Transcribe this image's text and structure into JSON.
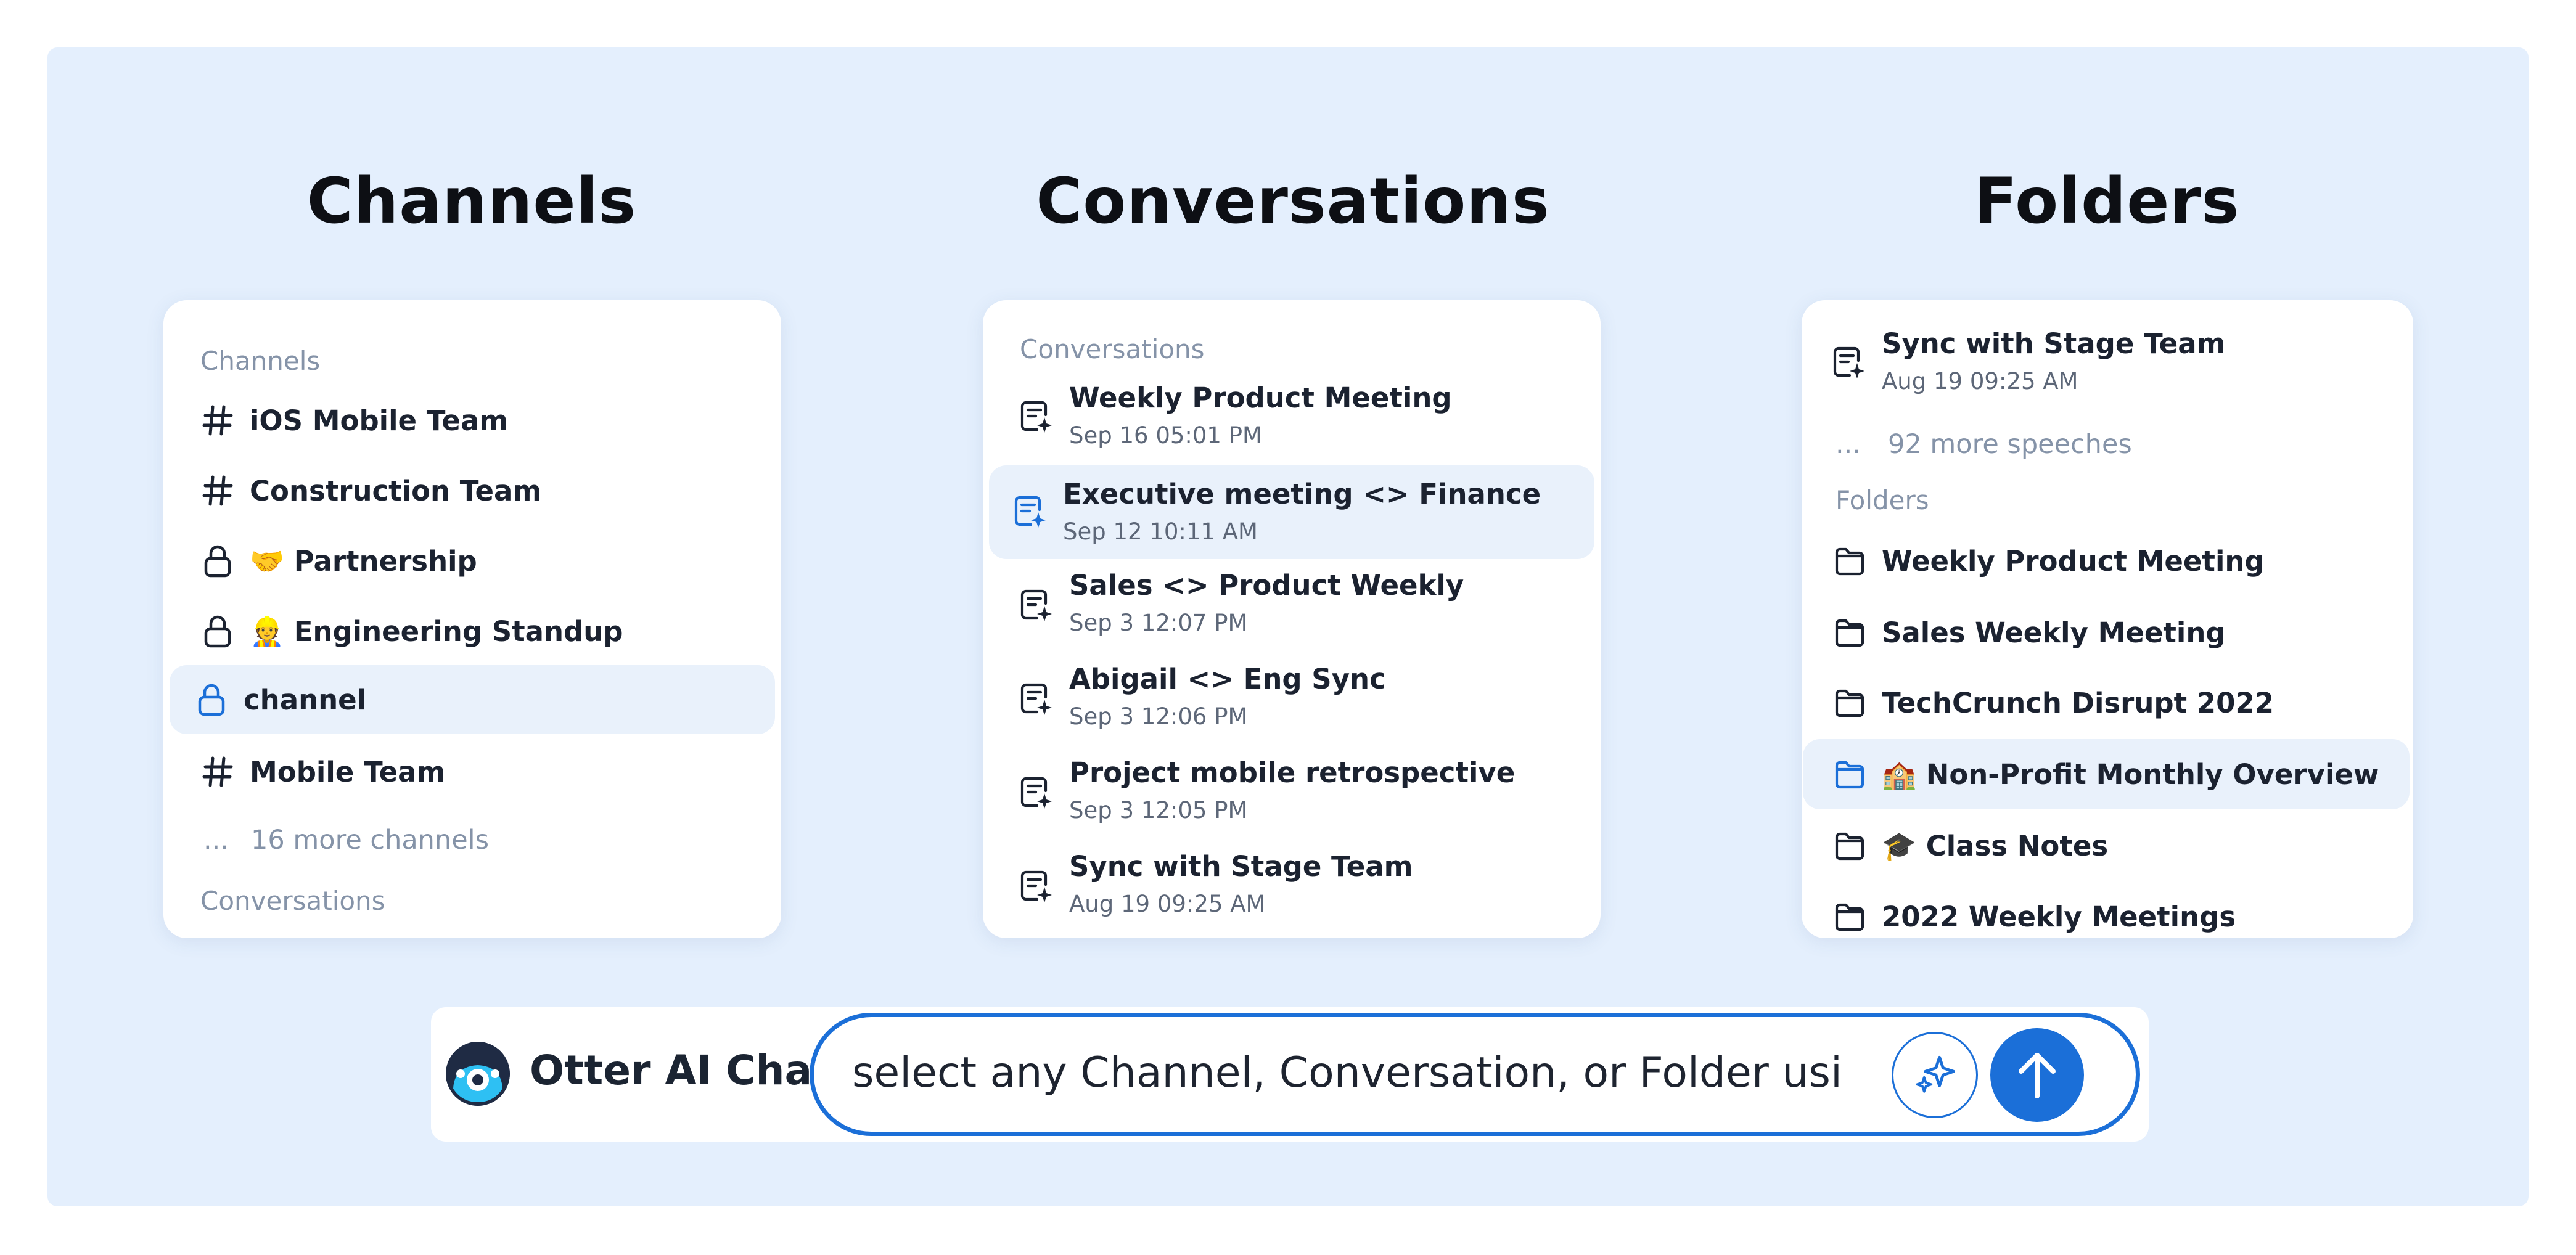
{
  "columns": {
    "channels": {
      "title": "Channels"
    },
    "conversations": {
      "title": "Conversations"
    },
    "folders": {
      "title": "Folders"
    }
  },
  "channels_card": {
    "section_label": "Channels",
    "items": [
      {
        "icon": "hash-icon",
        "label": "iOS Mobile Team"
      },
      {
        "icon": "hash-icon",
        "label": "Construction Team"
      },
      {
        "icon": "lock-icon",
        "label": "🤝 Partnership"
      },
      {
        "icon": "lock-icon",
        "label": "👷 Engineering Standup"
      },
      {
        "icon": "lock-icon",
        "label": "channel",
        "selected": true
      },
      {
        "icon": "hash-icon",
        "label": "Mobile Team"
      }
    ],
    "more_dots": "...",
    "more_text": "16 more channels",
    "next_section_label": "Conversations"
  },
  "conversations_card": {
    "section_label": "Conversations",
    "items": [
      {
        "icon": "ai-notes-icon",
        "title": "Weekly Product Meeting",
        "date": "Sep 16 05:01 PM"
      },
      {
        "icon": "ai-notes-icon",
        "title": "Executive meeting <> Finance",
        "date": "Sep 12 10:11 AM",
        "selected": true
      },
      {
        "icon": "ai-notes-icon",
        "title": "Sales <> Product Weekly",
        "date": "Sep 3 12:07 PM"
      },
      {
        "icon": "ai-notes-icon",
        "title": "Abigail <> Eng Sync",
        "date": "Sep 3 12:06 PM"
      },
      {
        "icon": "ai-notes-icon",
        "title": "Project mobile retrospective",
        "date": "Sep 3 12:05 PM"
      },
      {
        "icon": "ai-notes-icon",
        "title": "Sync with Stage Team",
        "date": "Aug 19 09:25 AM"
      }
    ]
  },
  "folders_card": {
    "top_item": {
      "icon": "ai-notes-icon",
      "title": "Sync with Stage Team",
      "date": "Aug 19 09:25 AM"
    },
    "more_dots": "...",
    "more_text": "92 more speeches",
    "section_label": "Folders",
    "items": [
      {
        "icon": "folder-icon",
        "label": "Weekly Product Meeting"
      },
      {
        "icon": "folder-icon",
        "label": "Sales Weekly Meeting"
      },
      {
        "icon": "folder-icon",
        "label": "TechCrunch Disrupt 2022"
      },
      {
        "icon": "folder-icon",
        "label": "🏫 Non-Profit Monthly Overview",
        "selected": true
      },
      {
        "icon": "folder-icon",
        "label": "🎓 Class Notes"
      },
      {
        "icon": "folder-icon",
        "label": "2022 Weekly Meetings"
      }
    ]
  },
  "chat": {
    "title": "Otter AI Chat",
    "input_value": "select any Channel, Conversation, or Folder using #",
    "spark_icon": "sparkle-icon",
    "send_icon": "arrow-up-icon"
  },
  "colors": {
    "background": "#e4effd",
    "accent": "#1b6fd8",
    "selected_row": "#e9f1fb",
    "muted_text": "#8593a8"
  }
}
